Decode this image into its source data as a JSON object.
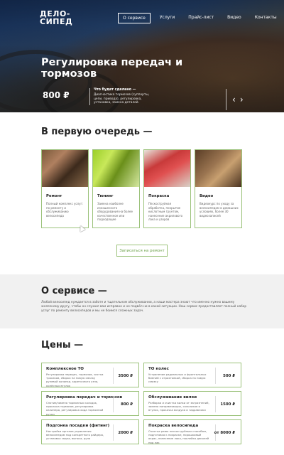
{
  "header": {
    "logo_line1": "ДЕЛО-",
    "logo_line2": "СИПЕД",
    "nav": [
      "О сервисе",
      "Услуги",
      "Прайс-лист",
      "Видео",
      "Контакты"
    ]
  },
  "hero": {
    "title": "Регулировка передач и тормозов",
    "price": "800 ₽",
    "desc_heading": "Что будет сделано —",
    "desc_text": "Диагностика тормозов (суппорты, цепи, привода), регулировка, установка, замена деталей.",
    "prev_arrow": "‹",
    "next_arrow": "›"
  },
  "first": {
    "heading": "В первую очередь —",
    "cards": [
      {
        "title": "Ремонт",
        "text": "Полный комплекс услуг: по ремонту и обслуживанию велосипеда"
      },
      {
        "title": "Тюнинг",
        "text": "Замена наиболее изношенного оборудования на более качественное или подходящее"
      },
      {
        "title": "Покраска",
        "text": "Пескоструйная обработка, покрытие кислотным грунтом, нанесение акрилового лака и узоров"
      },
      {
        "title": "Видео",
        "text": "Видеокурс по уходу за велосипедом в домашних условиях, более 30 видеозаписей"
      }
    ],
    "button": "Записаться на ремонт"
  },
  "about": {
    "heading": "О сервисе —",
    "text": "Любой велосипед нуждается в заботе и тщательном обслуживании, а наши мастера знают что именно нужно вашему железному другу, чтобы он служил вам исправно и не подвёл ни в какой ситуации. Наш сервис предоставляет полный набор услуг по ремонту велосипедов и мы не боимся сложных задач."
  },
  "prices": {
    "heading": "Цены —",
    "items": [
      {
        "title": "Комплексное ТО",
        "text": "Регулировка передач, тормозов, чистка тросиков, сборка на новую смазку рулевой колонки, кареточного узла, колёсных втулок",
        "price": "3500 ₽"
      },
      {
        "title": "ТО колес",
        "text": "Устранение радиальных и фронтальных биений с отрихтовкой, сборка на новую смазку",
        "price": "500 ₽"
      },
      {
        "title": "Регулировка передач и тормозов",
        "text": "Снятие/замена тормозных колодок, прокачка тормозов, регулировка калипера, регулировка хода тормозной ручки",
        "price": "800 ₽"
      },
      {
        "title": "Обслуживание вилки",
        "text": "Разборка и очистка вилки от загрязнений, замена направляющих, сальников и втулок, прокачка воздуха и гидравлики",
        "price": "1500 ₽"
      },
      {
        "title": "Подгонка посадки (фитинг)",
        "text": "Настройка органов управления велосипедом под конкретного райдера, установка седла, выноса, руля",
        "price": "2000 ₽"
      },
      {
        "title": "Покраска велосипеда",
        "text": "Очистка рамы пескоструйным способом, подготовка к покраске, порошковый окрас, нанесение лака, наклейка деколей под лак",
        "price": "от 8000 ₽"
      }
    ]
  },
  "colors": {
    "accent": "#9bc27a",
    "accent_text": "#6ca14a"
  }
}
